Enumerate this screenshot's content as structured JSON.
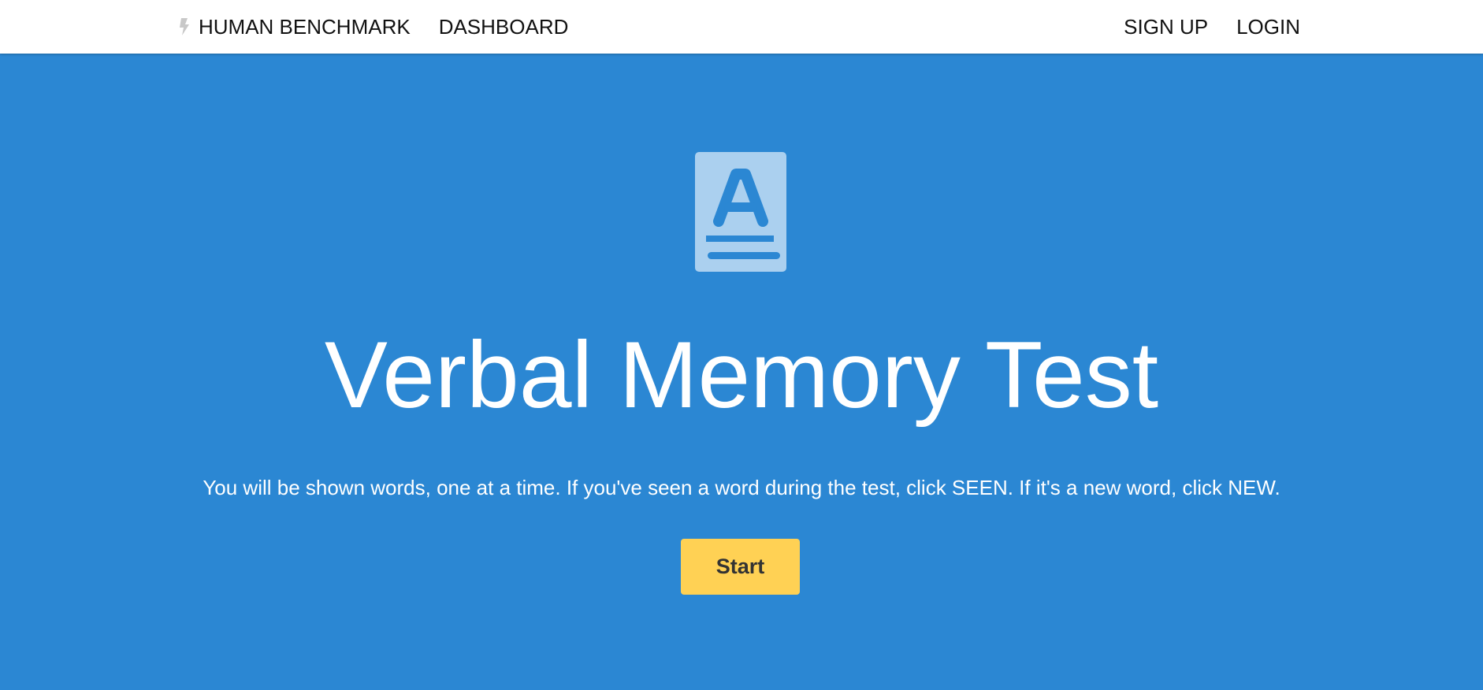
{
  "navbar": {
    "brand_label": "HUMAN BENCHMARK",
    "brand_icon": "bolt-icon",
    "dashboard_label": "DASHBOARD",
    "signup_label": "SIGN UP",
    "login_label": "LOGIN"
  },
  "hero": {
    "icon": "book-letter-a-icon",
    "title": "Verbal Memory Test",
    "description": "You will be shown words, one at a time. If you've seen a word during the test, click SEEN. If it's a new word, click NEW.",
    "start_label": "Start"
  },
  "colors": {
    "hero_background": "#2b87d3",
    "button_background": "#ffd154",
    "navbar_background": "#ffffff"
  }
}
